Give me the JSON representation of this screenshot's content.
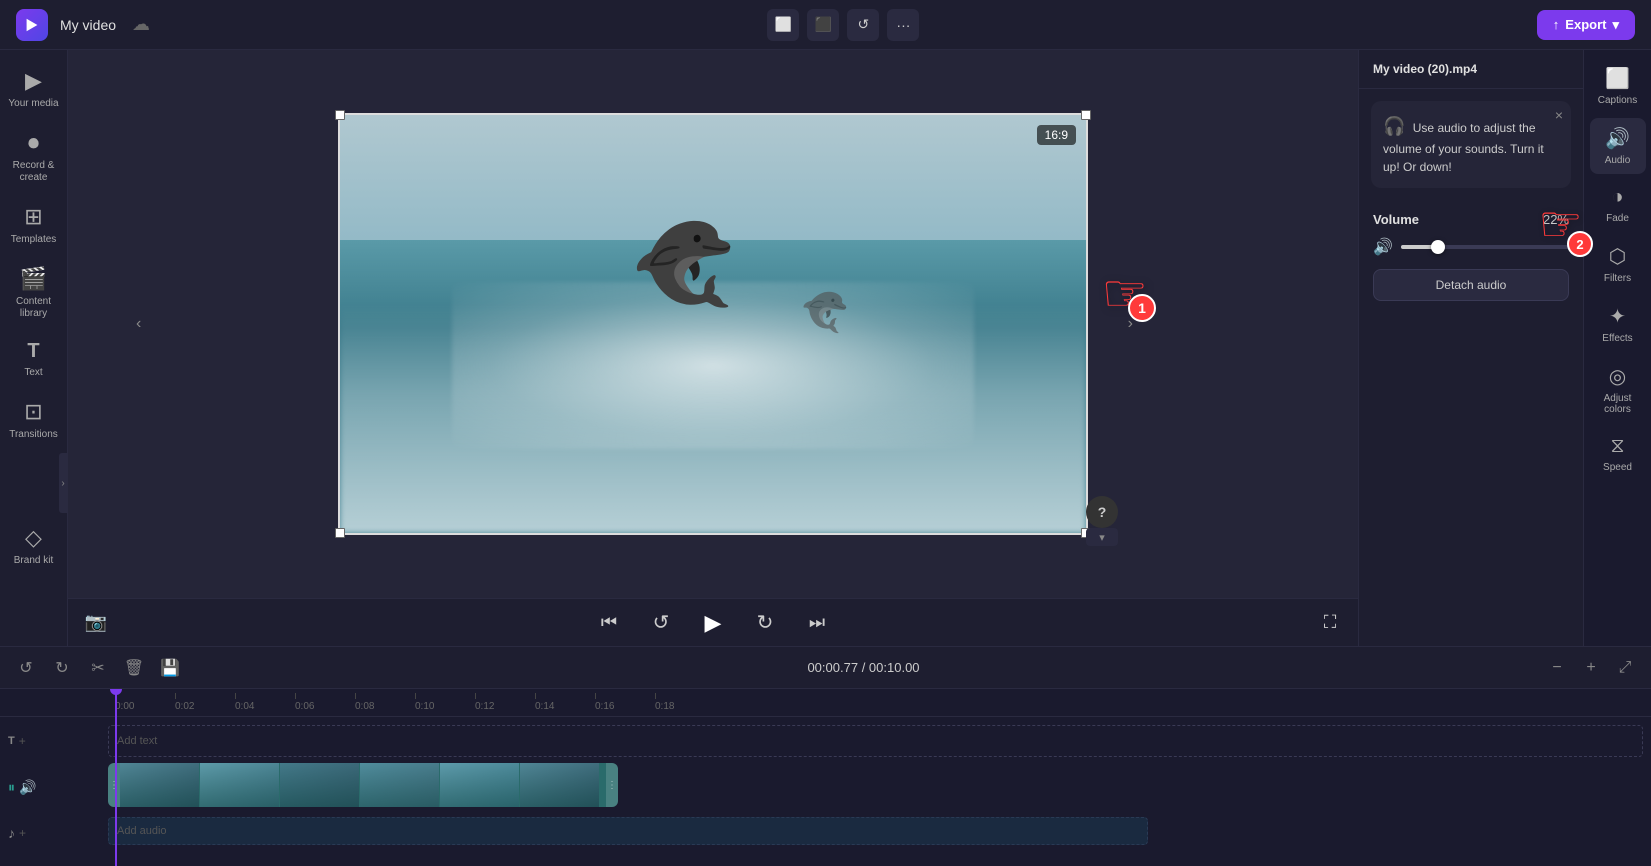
{
  "app": {
    "logo_color": "#7c3aed",
    "project_name": "My video"
  },
  "toolbar": {
    "crop_icon": "⬜",
    "frame_icon": "⬛",
    "rotate_icon": "↺",
    "more_icon": "···",
    "export_label": "Export"
  },
  "sidebar": {
    "items": [
      {
        "id": "your-media",
        "label": "Your media",
        "icon": "▶"
      },
      {
        "id": "record",
        "label": "Record &\ncreate",
        "icon": "⏺"
      },
      {
        "id": "templates",
        "label": "Templates",
        "icon": "⊞"
      },
      {
        "id": "content-library",
        "label": "Content library",
        "icon": "🎬"
      },
      {
        "id": "text",
        "label": "Text",
        "icon": "T"
      },
      {
        "id": "transitions",
        "label": "Transitions",
        "icon": "⊡"
      },
      {
        "id": "brand-kit",
        "label": "Brand kit",
        "icon": "◇"
      }
    ]
  },
  "tooltip": {
    "emoji": "🎧",
    "text": "Use audio to adjust the volume of your sounds. Turn it up! Or down!",
    "close_label": "×"
  },
  "volume": {
    "label": "Volume",
    "value": "22%",
    "percent": 22,
    "detach_label": "Detach audio"
  },
  "right_panel": {
    "file_name": "My video (20).mp4",
    "tabs": [
      {
        "id": "captions",
        "label": "Captions"
      },
      {
        "id": "audio",
        "label": "Audio"
      },
      {
        "id": "fade",
        "label": "Fade"
      },
      {
        "id": "filters",
        "label": "Filters"
      },
      {
        "id": "effects",
        "label": "Effects"
      },
      {
        "id": "adjust-colors",
        "label": "Adjust colors"
      },
      {
        "id": "speed",
        "label": "Speed"
      }
    ]
  },
  "video_controls": {
    "skip_back_icon": "⏮",
    "rewind_icon": "↺",
    "play_icon": "▶",
    "forward_icon": "↻",
    "skip_forward_icon": "⏭",
    "screenshot_icon": "📷",
    "fullscreen_icon": "⛶"
  },
  "ratio_badge": "16:9",
  "timeline": {
    "undo_icon": "↺",
    "redo_icon": "↻",
    "cut_icon": "✂",
    "delete_icon": "🗑",
    "save_icon": "💾",
    "time_current": "00:00.77",
    "time_total": "00:10.00",
    "zoom_in_icon": "+",
    "zoom_out_icon": "−",
    "expand_icon": "⤢",
    "ruler_marks": [
      "0:00",
      "0:02",
      "0:04",
      "0:06",
      "0:08",
      "0:10",
      "0:12",
      "0:14",
      "0:16",
      "0:18"
    ],
    "text_track_label": "Add text",
    "video_track_icon": "▶",
    "audio_track_label": "Add audio"
  },
  "help_btn_label": "?"
}
